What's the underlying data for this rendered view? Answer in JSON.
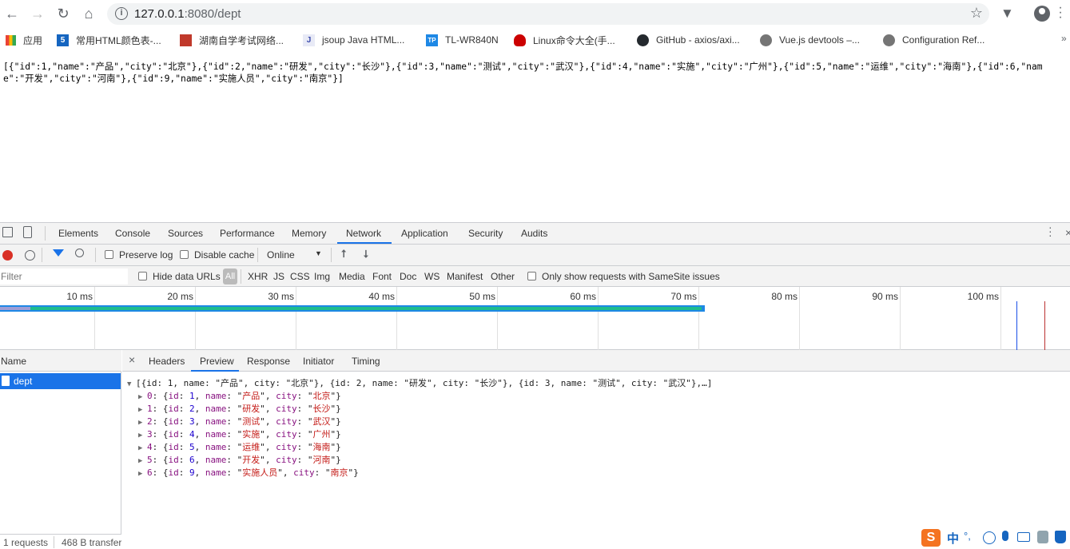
{
  "browser": {
    "url_host": "127.0.0.1",
    "url_port_path": ":8080/dept",
    "bookmarks": [
      {
        "label": "应用",
        "icon": "apps-grid-icon"
      },
      {
        "label": "常用HTML颜色表-...",
        "icon": "color-table-icon"
      },
      {
        "label": "湖南自学考试网络...",
        "icon": "exam-site-icon"
      },
      {
        "label": "jsoup Java HTML...",
        "icon": "jsoup-icon"
      },
      {
        "label": "TL-WR840N",
        "icon": "tplink-icon"
      },
      {
        "label": "Linux命令大全(手...",
        "icon": "redhat-icon"
      },
      {
        "label": "GitHub - axios/axi...",
        "icon": "github-icon"
      },
      {
        "label": "Vue.js devtools –...",
        "icon": "vue-devtools-icon"
      },
      {
        "label": "Configuration Ref...",
        "icon": "globe-icon"
      }
    ]
  },
  "page": {
    "raw_json": "[{\"id\":1,\"name\":\"产品\",\"city\":\"北京\"},{\"id\":2,\"name\":\"研发\",\"city\":\"长沙\"},{\"id\":3,\"name\":\"测试\",\"city\":\"武汉\"},{\"id\":4,\"name\":\"实施\",\"city\":\"广州\"},{\"id\":5,\"name\":\"运维\",\"city\":\"海南\"},{\"id\":6,\"name\":\"开发\",\"city\":\"河南\"},{\"id\":9,\"name\":\"实施人员\",\"city\":\"南京\"}]"
  },
  "devtools": {
    "tabs": [
      "Elements",
      "Console",
      "Sources",
      "Performance",
      "Memory",
      "Network",
      "Application",
      "Security",
      "Audits"
    ],
    "active_tab": "Network",
    "netbar": {
      "preserve_log": "Preserve log",
      "disable_cache": "Disable cache",
      "throttle": "Online"
    },
    "filterbar": {
      "filter_placeholder": "Filter",
      "hide_data_urls": "Hide data URLs",
      "types": [
        "All",
        "XHR",
        "JS",
        "CSS",
        "Img",
        "Media",
        "Font",
        "Doc",
        "WS",
        "Manifest",
        "Other"
      ],
      "samesite": "Only show requests with SameSite issues"
    },
    "timeline_ticks": [
      "10 ms",
      "20 ms",
      "30 ms",
      "40 ms",
      "50 ms",
      "60 ms",
      "70 ms",
      "80 ms",
      "90 ms",
      "100 ms"
    ],
    "name_header": "Name",
    "request_name": "dept",
    "status": {
      "requests": "1 requests",
      "transferred": "468 B transfer"
    },
    "preview_tabs": [
      "Headers",
      "Preview",
      "Response",
      "Initiator",
      "Timing"
    ],
    "active_preview_tab": "Preview",
    "preview_summary": "[{id: 1, name: \"产品\", city: \"北京\"}, {id: 2, name: \"研发\", city: \"长沙\"}, {id: 3, name: \"测试\", city: \"武汉\"},…]",
    "preview_items": [
      {
        "index": "0",
        "id": "1",
        "name": "产品",
        "city": "北京"
      },
      {
        "index": "1",
        "id": "2",
        "name": "研发",
        "city": "长沙"
      },
      {
        "index": "2",
        "id": "3",
        "name": "测试",
        "city": "武汉"
      },
      {
        "index": "3",
        "id": "4",
        "name": "实施",
        "city": "广州"
      },
      {
        "index": "4",
        "id": "5",
        "name": "运维",
        "city": "海南"
      },
      {
        "index": "5",
        "id": "6",
        "name": "开发",
        "city": "河南"
      },
      {
        "index": "6",
        "id": "9",
        "name": "实施人员",
        "city": "南京"
      }
    ]
  },
  "ime": {
    "lang": "中",
    "punct": "°,"
  }
}
